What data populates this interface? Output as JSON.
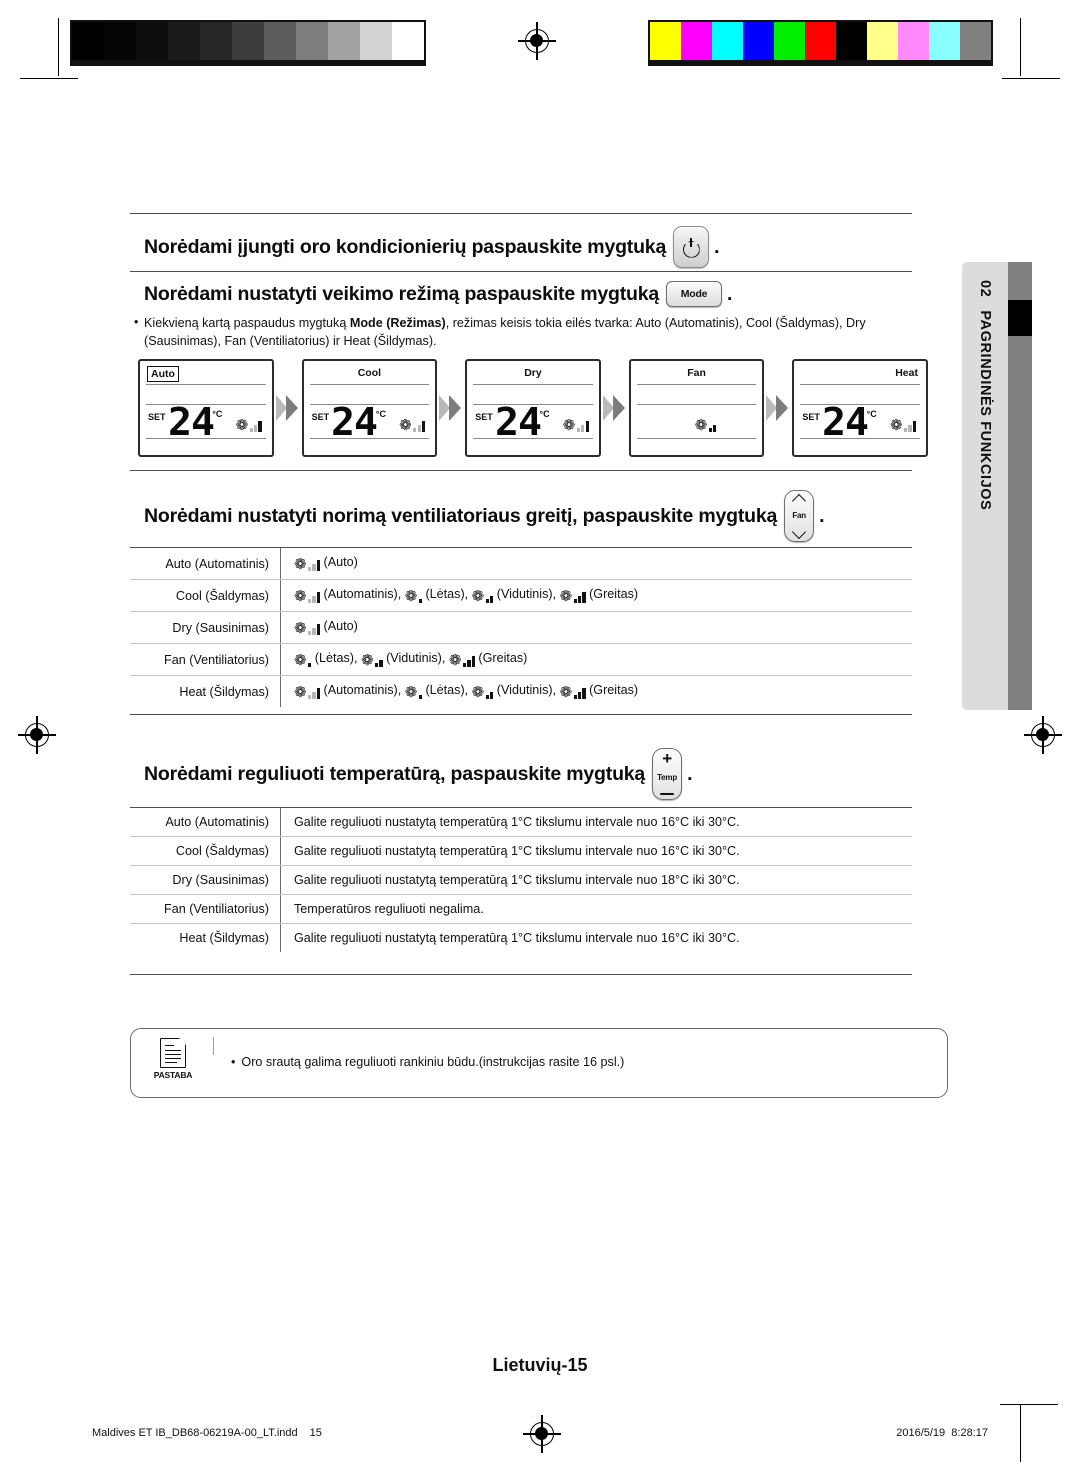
{
  "calibration": {
    "grayscale_steps": [
      "#000000",
      "#050505",
      "#0d0d0d",
      "#1a1a1a",
      "#262626",
      "#3d3d3d",
      "#5c5c5c",
      "#7d7d7d",
      "#a3a3a3",
      "#d2d2d2",
      "#ffffff"
    ],
    "color_swatches": [
      "#ffff00",
      "#ff00ff",
      "#00ffff",
      "#0000ff",
      "#00ee00",
      "#ff0000",
      "#000000",
      "#ffff8a",
      "#ff8aff",
      "#8affff",
      "#808080"
    ]
  },
  "sidebar": {
    "number": "02",
    "label": "PAGRINDINĖS FUNKCIJOS"
  },
  "section_power": {
    "heading_text": "Norėdami įjungti oro kondicionierių paspauskite mygtuką",
    "button_icon": "power-icon",
    "trailing_period": "."
  },
  "section_mode": {
    "heading_text": "Norėdami nustatyti veikimo režimą paspauskite mygtuką",
    "button_label": "Mode",
    "trailing_period": ".",
    "bullet_prefix": "Kiekvieną kartą paspaudus mygtuką ",
    "bullet_bold": "Mode (Režimas)",
    "bullet_suffix": ", režimas keisis tokia eilės tvarka: Auto (Automatinis), Cool (Šaldymas), Dry (Sausinimas), Fan (Ventiliatorius) ir Heat (Šildymas).",
    "panels": [
      {
        "label": "Auto",
        "label_align": "left",
        "boxed": true,
        "set_label": "SET",
        "temperature": "24",
        "degree": "°C",
        "fan": "auto",
        "show_temp": true
      },
      {
        "label": "Cool",
        "label_align": "center",
        "boxed": false,
        "set_label": "SET",
        "temperature": "24",
        "degree": "°C",
        "fan": "auto",
        "show_temp": true
      },
      {
        "label": "Dry",
        "label_align": "center",
        "boxed": false,
        "set_label": "SET",
        "temperature": "24",
        "degree": "°C",
        "fan": "auto",
        "show_temp": true
      },
      {
        "label": "Fan",
        "label_align": "center",
        "boxed": false,
        "set_label": "",
        "temperature": "",
        "degree": "",
        "fan": "medium",
        "show_temp": false
      },
      {
        "label": "Heat",
        "label_align": "right",
        "boxed": false,
        "set_label": "SET",
        "temperature": "24",
        "degree": "°C",
        "fan": "auto",
        "show_temp": true
      }
    ]
  },
  "section_fan": {
    "heading_text": "Norėdami nustatyti norimą ventiliatoriaus greitį, paspauskite mygtuką",
    "button_label": "Fan",
    "trailing_period": ".",
    "rows": [
      {
        "mode": "Auto (Automatinis)",
        "speeds": [
          {
            "icon": "auto",
            "text": "(Auto)"
          }
        ]
      },
      {
        "mode": "Cool (Šaldymas)",
        "speeds": [
          {
            "icon": "auto",
            "text": "(Automatinis),"
          },
          {
            "icon": "low",
            "text": "(Lėtas),"
          },
          {
            "icon": "medium",
            "text": "(Vidutinis),"
          },
          {
            "icon": "high",
            "text": "(Greitas)"
          }
        ]
      },
      {
        "mode": "Dry (Sausinimas)",
        "speeds": [
          {
            "icon": "auto",
            "text": "(Auto)"
          }
        ]
      },
      {
        "mode": "Fan (Ventiliatorius)",
        "speeds": [
          {
            "icon": "low",
            "text": "(Lėtas),"
          },
          {
            "icon": "medium",
            "text": "(Vidutinis),"
          },
          {
            "icon": "high",
            "text": "(Greitas)"
          }
        ]
      },
      {
        "mode": "Heat (Šildymas)",
        "speeds": [
          {
            "icon": "auto",
            "text": "(Automatinis),"
          },
          {
            "icon": "low",
            "text": "(Lėtas),"
          },
          {
            "icon": "medium",
            "text": "(Vidutinis),"
          },
          {
            "icon": "high",
            "text": "(Greitas)"
          }
        ]
      }
    ]
  },
  "section_temp": {
    "heading_text": "Norėdami reguliuoti temperatūrą, paspauskite mygtuką",
    "button_label": "Temp",
    "button_plus": "+",
    "button_minus": "−",
    "trailing_period": ".",
    "rows": [
      {
        "mode": "Auto (Automatinis)",
        "text": "Galite reguliuoti nustatytą temperatūrą 1°C tikslumu intervale nuo 16°C iki 30°C."
      },
      {
        "mode": "Cool (Šaldymas)",
        "text": "Galite reguliuoti nustatytą temperatūrą 1°C tikslumu intervale nuo 16°C iki 30°C."
      },
      {
        "mode": "Dry (Sausinimas)",
        "text": "Galite reguliuoti nustatytą temperatūrą 1°C tikslumu intervale nuo 18°C iki 30°C."
      },
      {
        "mode": "Fan (Ventiliatorius)",
        "text": "Temperatūros reguliuoti negalima."
      },
      {
        "mode": "Heat (Šildymas)",
        "text": "Galite reguliuoti nustatytą temperatūrą 1°C tikslumu intervale nuo 16°C iki 30°C."
      }
    ]
  },
  "note": {
    "icon_label": "PASTABA",
    "bullet": "•",
    "text": "Oro srautą galima reguliuoti rankiniu būdu.(instrukcijas rasite 16 psl.)"
  },
  "footer": {
    "page_label": "Lietuvių-15",
    "file_name": "Maldives ET IB_DB68-06219A-00_LT.indd",
    "file_page": "15",
    "date": "2016/5/19",
    "time": "8:28:17"
  }
}
